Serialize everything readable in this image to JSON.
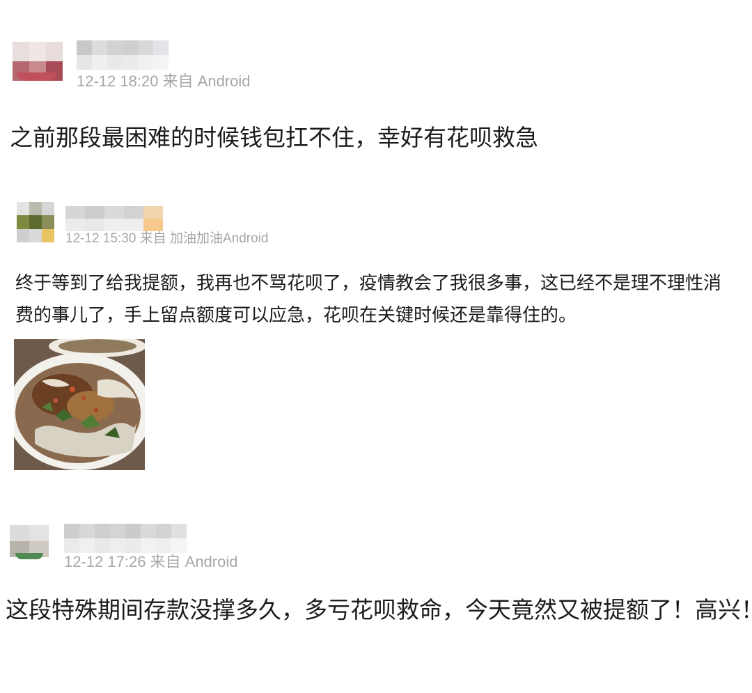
{
  "comments": [
    {
      "meta": "12-12 18:20 来自 Android",
      "text": "之前那段最困难的时候钱包扛不住，幸好有花呗救急"
    },
    {
      "meta": "12-12 15:30 来自 加油加油Android",
      "text": "终于等到了给我提额，我再也不骂花呗了，疫情教会了我很多事，这已经不是理不理性消费的事儿了，手上留点额度可以应急，花呗在关键时候还是靠得住的。",
      "image": "noodle-soup-photo"
    },
    {
      "meta": "12-12 17:26 来自 Android",
      "text": "这段特殊期间存款没撑多久，多亏花呗救命，今天竟然又被提额了！高兴！"
    }
  ],
  "colors": {
    "meta_text": "#a6a6a6",
    "body_text": "#1c1c1c",
    "background": "#ffffff"
  }
}
